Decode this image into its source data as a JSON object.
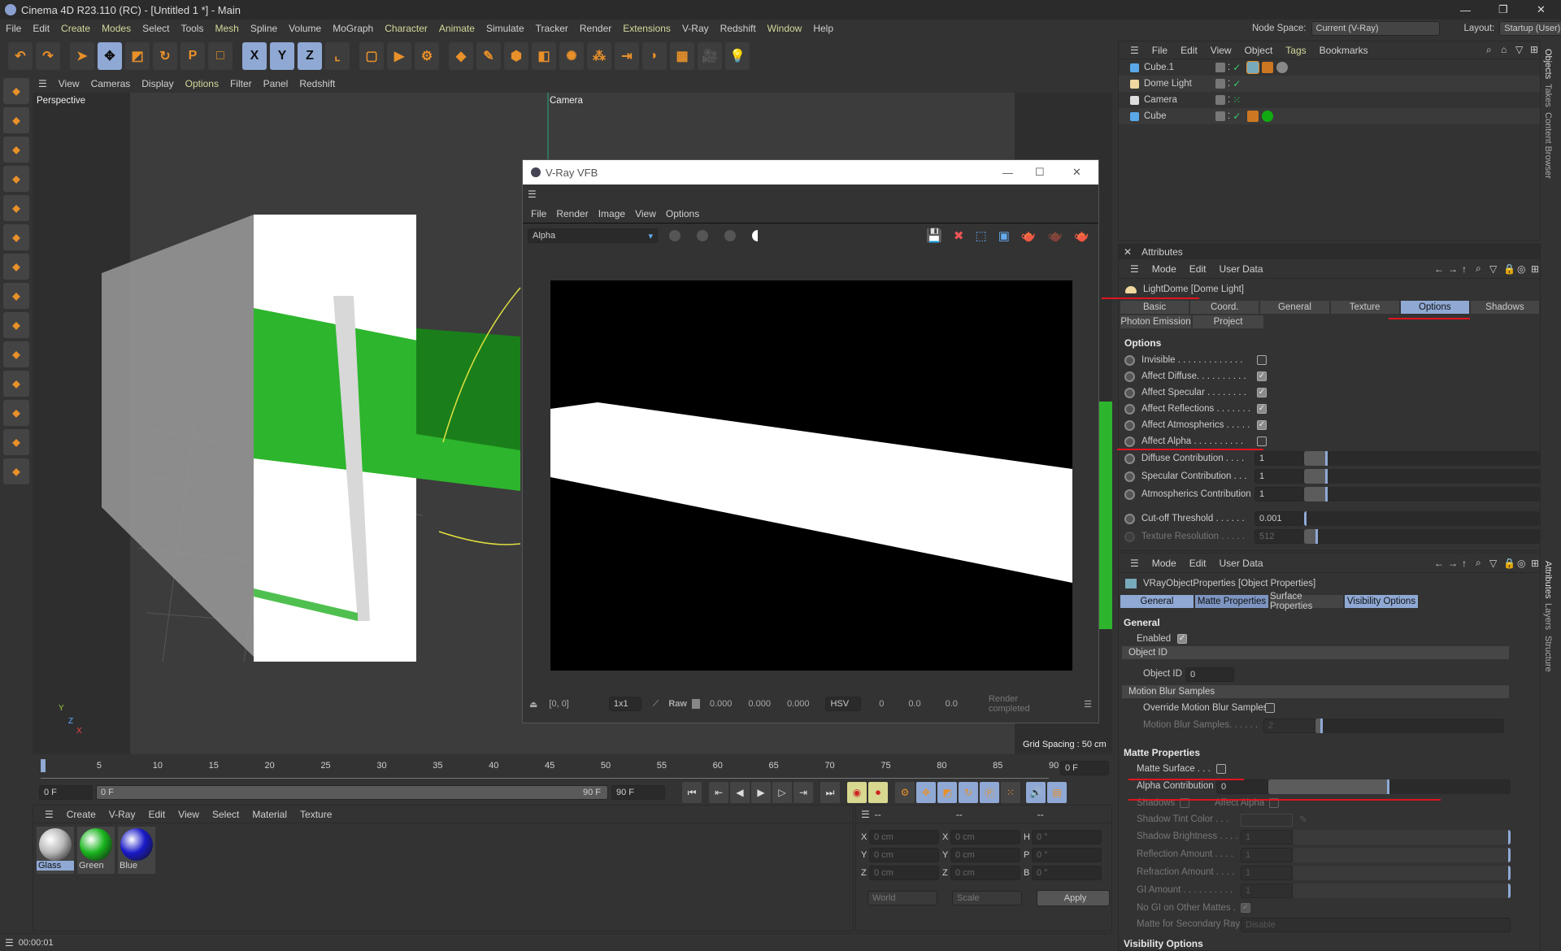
{
  "app": {
    "title": "Cinema 4D R23.110 (RC) - [Untitled 1 *] - Main",
    "minimize": "—",
    "restore": "❐",
    "close": "✕"
  },
  "menu": {
    "items": [
      {
        "label": "File"
      },
      {
        "label": "Edit"
      },
      {
        "label": "Create",
        "hl": true
      },
      {
        "label": "Modes",
        "hl": true
      },
      {
        "label": "Select"
      },
      {
        "label": "Tools"
      },
      {
        "label": "Mesh",
        "hl": true
      },
      {
        "label": "Spline"
      },
      {
        "label": "Volume"
      },
      {
        "label": "MoGraph"
      },
      {
        "label": "Character",
        "hl": true
      },
      {
        "label": "Animate",
        "hl": true
      },
      {
        "label": "Simulate"
      },
      {
        "label": "Tracker"
      },
      {
        "label": "Render"
      },
      {
        "label": "Extensions",
        "hl": true
      },
      {
        "label": "V-Ray"
      },
      {
        "label": "Redshift"
      },
      {
        "label": "Window",
        "hl": true
      },
      {
        "label": "Help"
      }
    ]
  },
  "header": {
    "node_space_label": "Node Space:",
    "node_space_value": "Current (V-Ray)",
    "layout_label": "Layout:",
    "layout_value": "Startup (User)"
  },
  "toolbar": {
    "icons": [
      {
        "name": "undo",
        "glyph": "↶"
      },
      {
        "name": "redo",
        "glyph": "↷"
      },
      {
        "name": "select",
        "glyph": "➤"
      },
      {
        "name": "move",
        "glyph": "✥",
        "blue": true
      },
      {
        "name": "scale",
        "glyph": "◩"
      },
      {
        "name": "rotate",
        "glyph": "↻"
      },
      {
        "name": "psr",
        "glyph": "P"
      },
      {
        "name": "null",
        "glyph": "□"
      },
      {
        "name": "x-axis",
        "glyph": "X",
        "blue": true
      },
      {
        "name": "y-axis",
        "glyph": "Y",
        "blue": true
      },
      {
        "name": "z-axis",
        "glyph": "Z",
        "blue": true
      },
      {
        "name": "coordinate-system",
        "glyph": "⌞"
      },
      {
        "name": "render-region",
        "glyph": "▢"
      },
      {
        "name": "render-view",
        "glyph": "▶"
      },
      {
        "name": "render-settings",
        "glyph": "⚙"
      },
      {
        "name": "cube",
        "glyph": "◆"
      },
      {
        "name": "pen",
        "glyph": "✎"
      },
      {
        "name": "subdivision",
        "glyph": "⬢"
      },
      {
        "name": "extrude",
        "glyph": "◧"
      },
      {
        "name": "cloner",
        "glyph": "✺"
      },
      {
        "name": "array",
        "glyph": "⁂"
      },
      {
        "name": "deformer",
        "glyph": "⇥"
      },
      {
        "name": "bend",
        "glyph": "◗"
      },
      {
        "name": "floor",
        "glyph": "▦"
      },
      {
        "name": "camera",
        "glyph": "🎥"
      },
      {
        "name": "light",
        "glyph": "💡"
      }
    ]
  },
  "left_toolbar": {
    "icons": [
      "model-mode",
      "texture-mode",
      "points",
      "edges",
      "polygons",
      "object-mode",
      "axis",
      "snap",
      "soft-select-s1",
      "soft-select-s2",
      "magnet",
      "workplane",
      "grid",
      "quantize"
    ]
  },
  "viewport": {
    "menu": [
      "View",
      "Cameras",
      "Display",
      "Options",
      "Filter",
      "Panel",
      "Redshift"
    ],
    "highlight": "Options",
    "label": "Perspective",
    "camera_label": "Camera",
    "grid_spacing": "Grid Spacing : 50 cm",
    "axis_y": "Y",
    "axis_z": "Z",
    "axis_x": "X"
  },
  "vfb": {
    "title": "V-Ray VFB",
    "menu": [
      "File",
      "Render",
      "Image",
      "View",
      "Options"
    ],
    "channel": "Alpha",
    "coords": "[0, 0]",
    "zoom": "1x1",
    "raw_label": "Raw",
    "rgb": [
      "0.000",
      "0.000",
      "0.000"
    ],
    "color_mode": "HSV",
    "hsv": [
      "0",
      "0.0",
      "0.0"
    ],
    "status": "Render completed"
  },
  "timeline": {
    "ticks": [
      "0",
      "5",
      "10",
      "15",
      "20",
      "25",
      "30",
      "35",
      "40",
      "45",
      "50",
      "55",
      "60",
      "65",
      "70",
      "75",
      "80",
      "85",
      "90"
    ],
    "current_frame": "0 F",
    "start": "0 F",
    "range_start": "0 F",
    "range_end": "90 F",
    "end": "90 F"
  },
  "materials": {
    "menu": [
      "Create",
      "V-Ray",
      "Edit",
      "View",
      "Select",
      "Material",
      "Texture"
    ],
    "items": [
      {
        "name": "Glass",
        "color": "#b8b8b8",
        "selected": true
      },
      {
        "name": "Green",
        "color": "#19b51e"
      },
      {
        "name": "Blue",
        "color": "#1a1ac8"
      }
    ]
  },
  "coords": {
    "headers": [
      "--",
      "--",
      "--"
    ],
    "rows": [
      {
        "a": "X",
        "av": "0 cm",
        "b": "X",
        "bv": "0 cm",
        "c": "H",
        "cv": "0 °"
      },
      {
        "a": "Y",
        "av": "0 cm",
        "b": "Y",
        "bv": "0 cm",
        "c": "P",
        "cv": "0 °"
      },
      {
        "a": "Z",
        "av": "0 cm",
        "b": "Z",
        "bv": "0 cm",
        "c": "B",
        "cv": "0 °"
      }
    ],
    "space": "World",
    "mode": "Scale",
    "apply": "Apply"
  },
  "status": {
    "time": "00:00:01"
  },
  "objects": {
    "menu": [
      "File",
      "Edit",
      "View",
      "Object",
      "Tags",
      "Bookmarks"
    ],
    "highlight": "Tags",
    "items": [
      {
        "name": "Cube.1",
        "icon": "cube",
        "tags": [
          "vray-object-properties",
          "material-dots",
          "glass-material"
        ]
      },
      {
        "name": "Dome Light",
        "icon": "dome-light",
        "tags": []
      },
      {
        "name": "Camera",
        "icon": "camera",
        "tags": []
      },
      {
        "name": "Cube",
        "icon": "cube",
        "tags": [
          "material-dots",
          "green-material"
        ]
      }
    ],
    "side_tabs": [
      "Objects",
      "Takes",
      "Content Browser"
    ]
  },
  "attr1": {
    "panel_title": "Attributes",
    "menu": [
      "Mode",
      "Edit",
      "User Data"
    ],
    "object": "LightDome [Dome Light]",
    "tabs": [
      [
        "Basic",
        "Coord.",
        "General",
        "Texture",
        "Options",
        "Shadows"
      ],
      [
        "Photon Emission",
        "Project"
      ]
    ],
    "active_tab": "Options",
    "section": "Options",
    "checks": [
      {
        "label": "Invisible . . . . . . . . . . . . .",
        "checked": false
      },
      {
        "label": "Affect Diffuse. . . . . . . . . .",
        "checked": true
      },
      {
        "label": "Affect Specular . . . . . . . .",
        "checked": true
      },
      {
        "label": "Affect Reflections . . . . . . .",
        "checked": true
      },
      {
        "label": "Affect Atmospherics . . . . .",
        "checked": true
      },
      {
        "label": "Affect Alpha . . . . . . . . . .",
        "checked": false
      }
    ],
    "numbers": [
      {
        "label": "Diffuse Contribution . . . .",
        "value": "1",
        "slider_fraction": 0.1
      },
      {
        "label": "Specular Contribution . . .",
        "value": "1",
        "slider_fraction": 0.1
      },
      {
        "label": "Atmospherics Contribution",
        "value": "1",
        "slider_fraction": 0.1
      },
      {
        "label": "Cut-off Threshold . . . . . .",
        "value": "0.001",
        "slider_fraction": 0.005
      },
      {
        "label": "Texture Resolution . . . . .",
        "value": "512",
        "slider_fraction": 0.06,
        "disabled": true
      }
    ]
  },
  "attr2": {
    "menu": [
      "Mode",
      "Edit",
      "User Data"
    ],
    "object": "VRayObjectProperties [Object Properties]",
    "tabs": [
      "General",
      "Matte Properties",
      "Surface Properties",
      "Visibility Options"
    ],
    "general": "General",
    "enabled": "Enabled",
    "object_id_group": "Object ID",
    "object_id_label": "Object ID",
    "object_id": "0",
    "motion_group": "Motion Blur Samples",
    "override_mb": "Override Motion Blur Samples",
    "mb_samples_label": "Motion Blur Samples. . . . . .",
    "mb_samples": "2",
    "matte_section": "Matte Properties",
    "matte_surface": "Matte Surface . . .",
    "alpha_contribution_label": "Alpha Contribution",
    "alpha_contribution": "0",
    "alpha_slider_fraction": 0.5,
    "shadows": "Shadows",
    "affect_alpha": "Affect Alpha",
    "shadow_tint": "Shadow Tint Color . . .",
    "disabled_numbers": [
      {
        "label": "Shadow Brightness . . . .",
        "value": "1"
      },
      {
        "label": "Reflection Amount . . . .",
        "value": "1"
      },
      {
        "label": "Refraction Amount . . . .",
        "value": "1"
      },
      {
        "label": "GI Amount . . . . . . . . . .",
        "value": "1"
      }
    ],
    "no_gi": "No GI on Other Mattes .",
    "secondary_label": "Matte for Secondary Rays",
    "secondary_value": "Disable",
    "visibility_section": "Visibility Options",
    "side_tabs": [
      "Attributes",
      "Layers",
      "Structure"
    ]
  },
  "colors": {
    "accent": "#8fa9d4",
    "annotation": "#e0141e",
    "green": "#22b022"
  }
}
